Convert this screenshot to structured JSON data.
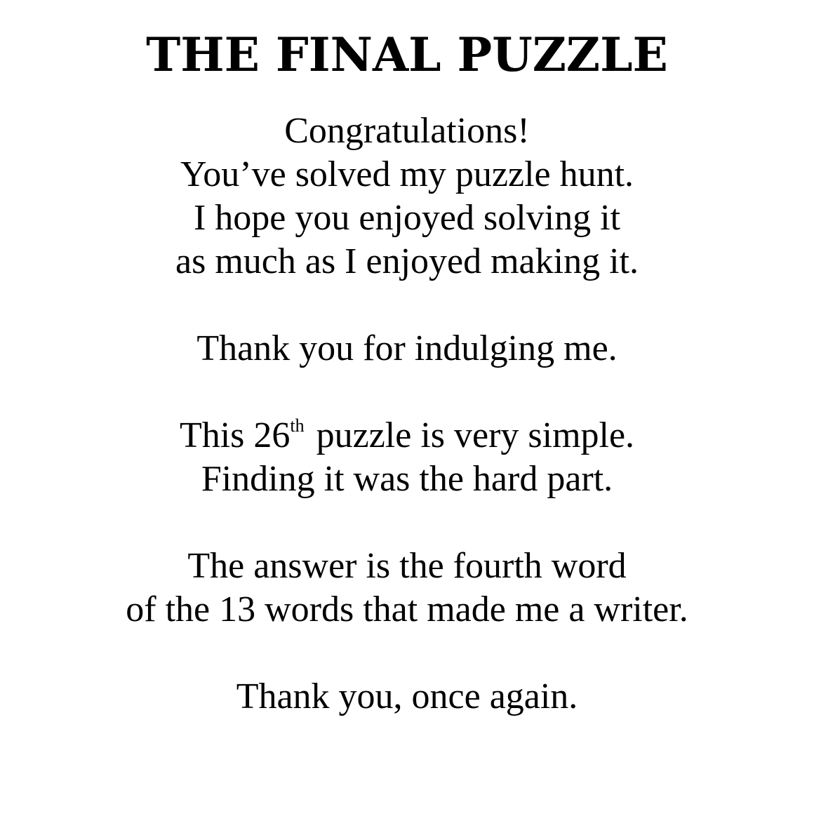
{
  "title": "THE FINAL PUZZLE",
  "paragraph1": {
    "line1": "Congratulations!",
    "line2": "You’ve solved my puzzle hunt.",
    "line3": "I hope you enjoyed solving it",
    "line4": "as much as I enjoyed making it."
  },
  "paragraph2": {
    "line1": "Thank you for indulging me."
  },
  "paragraph3": {
    "line1_pre": "This 26",
    "line1_sup": "th",
    "line1_post": " puzzle is very simple.",
    "line2": "Finding it was the hard part."
  },
  "paragraph4": {
    "line1": "The answer is the fourth word",
    "line2": "of the 13 words that made me a writer."
  },
  "paragraph5": {
    "line1": "Thank you, once again."
  }
}
